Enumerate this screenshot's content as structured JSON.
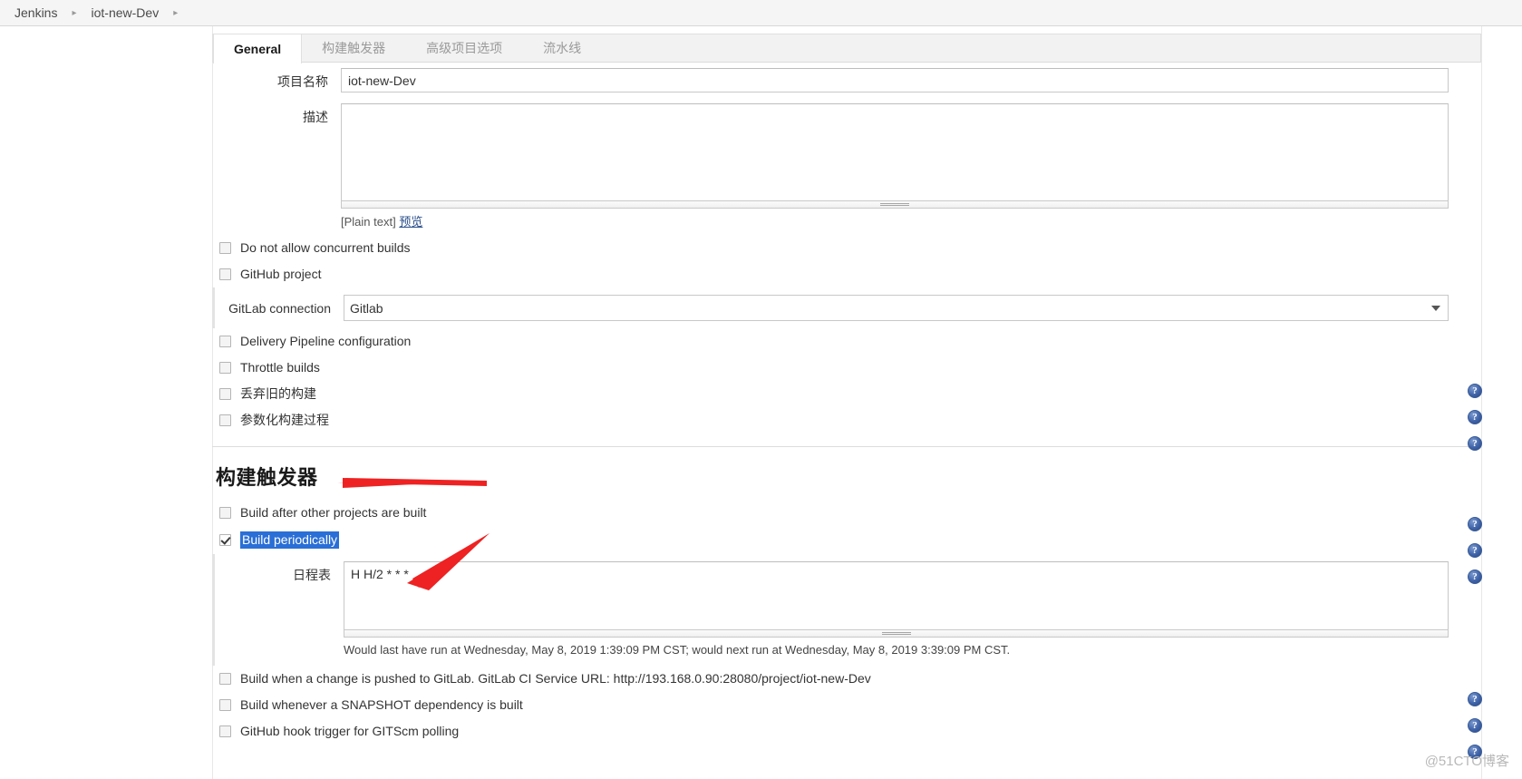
{
  "breadcrumb": {
    "items": [
      {
        "label": "Jenkins"
      },
      {
        "label": "iot-new-Dev"
      }
    ],
    "separator": "▸"
  },
  "tabs": [
    {
      "label": "General",
      "active": true
    },
    {
      "label": "构建触发器",
      "active": false
    },
    {
      "label": "高级项目选项",
      "active": false
    },
    {
      "label": "流水线",
      "active": false
    }
  ],
  "general": {
    "project_name": {
      "label": "项目名称",
      "value": "iot-new-Dev",
      "placeholder": ""
    },
    "description": {
      "label": "描述",
      "value": "",
      "placeholder": "",
      "format_note": "[Plain text]",
      "preview_link": "预览"
    },
    "checkboxes": [
      {
        "label": "Do not allow concurrent builds",
        "checked": false,
        "help": false
      },
      {
        "label": "GitHub project",
        "checked": false,
        "help": false
      }
    ],
    "gitlab_connection": {
      "label": "GitLab connection",
      "value": "Gitlab",
      "options": [
        "Gitlab"
      ]
    },
    "checkboxes2": [
      {
        "label": "Delivery Pipeline configuration",
        "checked": false,
        "help": false
      },
      {
        "label": "Throttle builds",
        "checked": false,
        "help": true
      },
      {
        "label": "丢弃旧的构建",
        "checked": false,
        "help": true
      },
      {
        "label": "参数化构建过程",
        "checked": false,
        "help": true
      }
    ]
  },
  "build_triggers": {
    "title": "构建触发器",
    "rows": [
      {
        "label": "Build after other projects are built",
        "checked": false,
        "help": true,
        "selected": false
      },
      {
        "label": "Build periodically",
        "checked": true,
        "help": true,
        "selected": true
      }
    ],
    "schedule": {
      "label": "日程表",
      "value": "H H/2 * * *",
      "placeholder": "",
      "help": true,
      "hint": "Would last have run at Wednesday, May 8, 2019 1:39:09 PM CST; would next run at Wednesday, May 8, 2019 3:39:09 PM CST."
    },
    "rows_after": [
      {
        "label": "Build when a change is pushed to GitLab. GitLab CI Service URL: http://193.168.0.90:28080/project/iot-new-Dev",
        "checked": false,
        "help": true
      },
      {
        "label": "Build whenever a SNAPSHOT dependency is built",
        "checked": false,
        "help": true
      },
      {
        "label": "GitHub hook trigger for GITScm polling",
        "checked": false,
        "help": false
      }
    ]
  },
  "help_icon_glyph": "?",
  "watermark": "@51CTO博客",
  "colors": {
    "accent_selection": "#2a6fd6",
    "arrow_red": "#ee2222",
    "help_blue": "#3f63a8",
    "tab_active_bg": "#ffffff",
    "tab_bar_bg": "#f2f2f2"
  },
  "annotations": [
    {
      "name": "arrow-to-build-triggers-title"
    },
    {
      "name": "arrow-to-schedule-field"
    }
  ]
}
